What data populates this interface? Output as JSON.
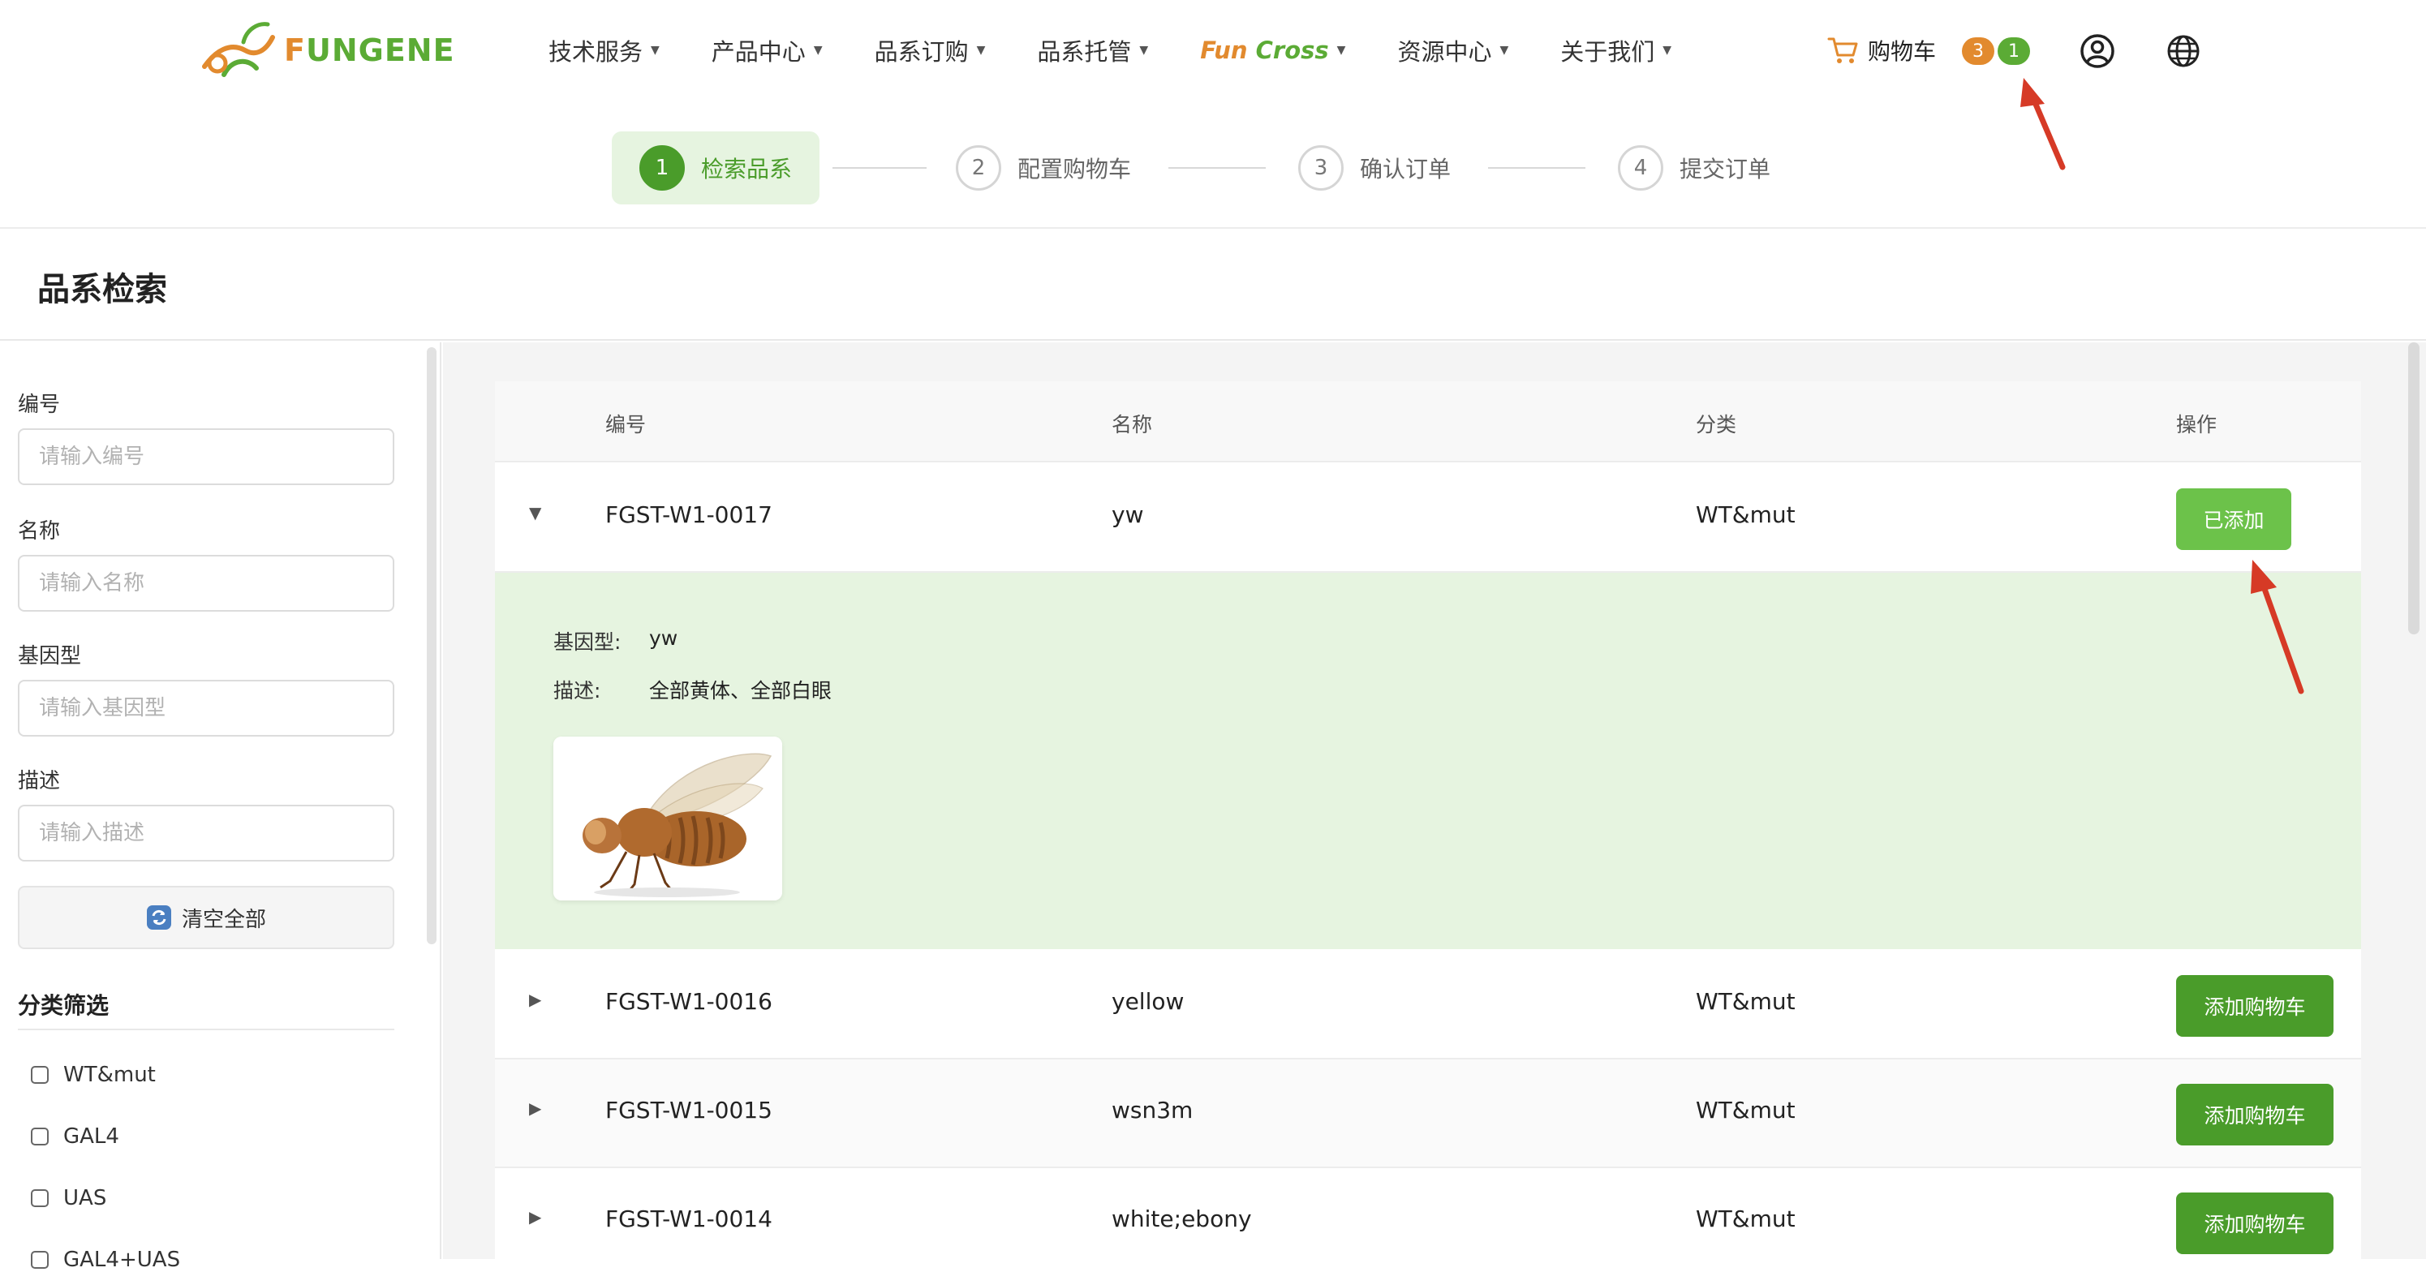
{
  "brand": {
    "logo_accent": "F",
    "logo_text": "UNGENE"
  },
  "nav": {
    "items": [
      {
        "label": "技术服务"
      },
      {
        "label": "产品中心"
      },
      {
        "label": "品系订购"
      },
      {
        "label": "品系托管"
      },
      {
        "label_a": "Fun",
        "label_b": "Cross"
      },
      {
        "label": "资源中心"
      },
      {
        "label": "关于我们"
      }
    ]
  },
  "cart": {
    "label": "购物车",
    "badge_count_a": "3",
    "badge_count_b": "1"
  },
  "steps": [
    {
      "num": "1",
      "label": "检索品系"
    },
    {
      "num": "2",
      "label": "配置购物车"
    },
    {
      "num": "3",
      "label": "确认订单"
    },
    {
      "num": "4",
      "label": "提交订单"
    }
  ],
  "page": {
    "title": "品系检索"
  },
  "sidebar": {
    "fields": [
      {
        "label": "编号",
        "placeholder": "请输入编号"
      },
      {
        "label": "名称",
        "placeholder": "请输入名称"
      },
      {
        "label": "基因型",
        "placeholder": "请输入基因型"
      },
      {
        "label": "描述",
        "placeholder": "请输入描述"
      }
    ],
    "clear_label": "清空全部",
    "filter_title": "分类筛选",
    "filters": [
      "WT&mut",
      "GAL4",
      "UAS",
      "GAL4+UAS"
    ]
  },
  "table": {
    "headers": {
      "id": "编号",
      "name": "名称",
      "category": "分类",
      "action": "操作"
    },
    "rows": [
      {
        "id": "FGST-W1-0017",
        "name": "yw",
        "category": "WT&mut",
        "action": "已添加",
        "expanded": true
      },
      {
        "id": "FGST-W1-0016",
        "name": "yellow",
        "category": "WT&mut",
        "action": "添加购物车"
      },
      {
        "id": "FGST-W1-0015",
        "name": "wsn3m",
        "category": "WT&mut",
        "action": "添加购物车"
      },
      {
        "id": "FGST-W1-0014",
        "name": "white;ebony",
        "category": "WT&mut",
        "action": "添加购物车"
      }
    ],
    "detail": {
      "genotype_label": "基因型:",
      "genotype_value": "yw",
      "description_label": "描述:",
      "description_value": "全部黄体、全部白眼"
    }
  },
  "icons": {
    "cart": "cart-icon",
    "user": "user-circle-icon",
    "globe": "globe-icon",
    "refresh": "refresh-icon",
    "expand": "triangle-down-icon",
    "collapse": "triangle-right-icon"
  },
  "colors": {
    "brand_green": "#4a9c2a",
    "brand_orange": "#e28a2e",
    "added_green": "#6cc24a",
    "detail_bg": "#e6f4e0",
    "annotation_red": "#d63a26"
  }
}
